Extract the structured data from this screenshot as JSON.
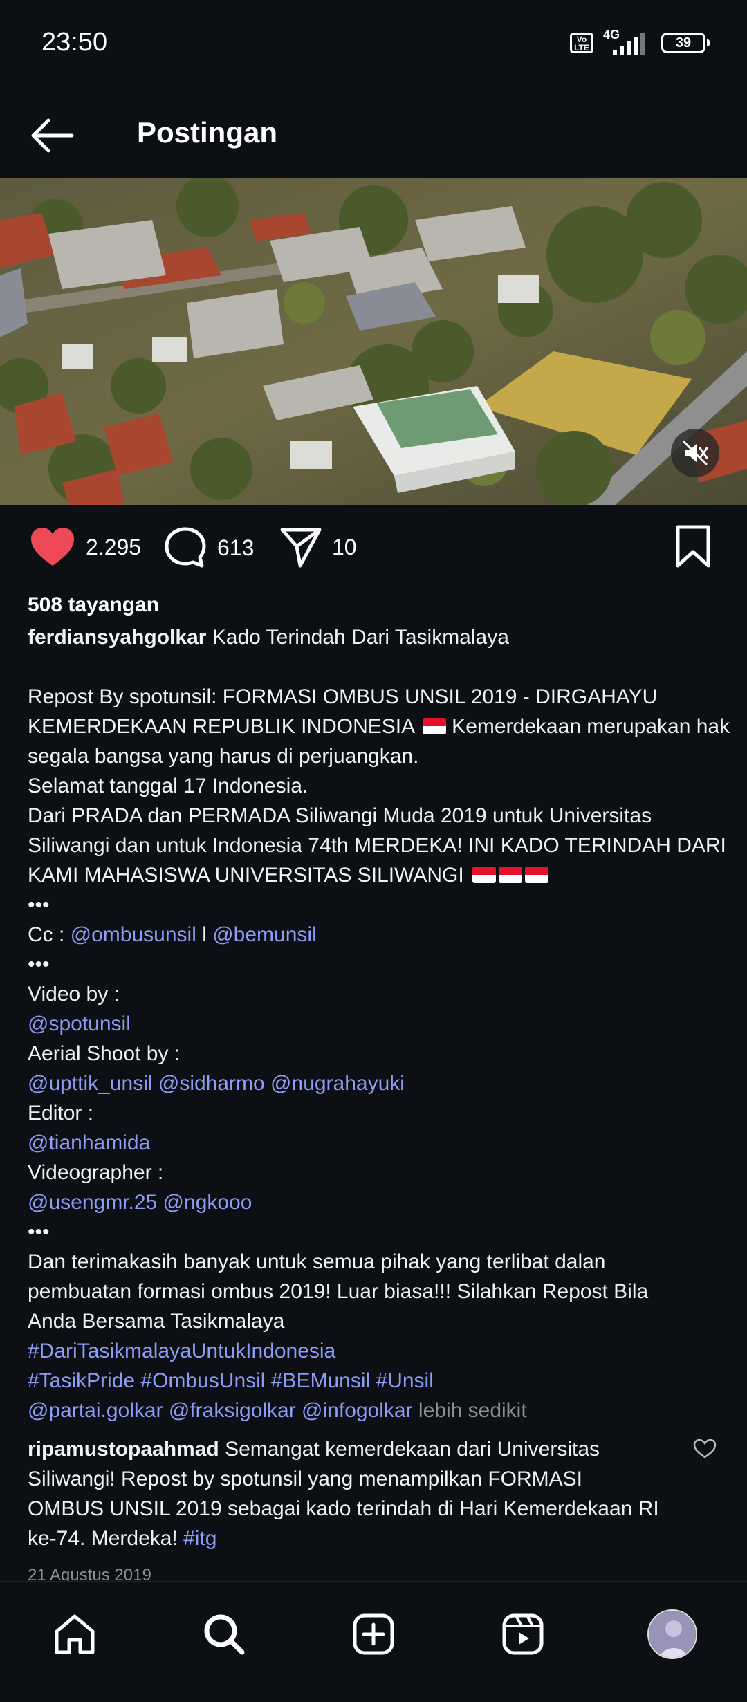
{
  "status": {
    "time": "23:50",
    "network": "4G",
    "volte_top": "Vo",
    "volte_bottom": "LTE",
    "battery": "39"
  },
  "header": {
    "title": "Postingan"
  },
  "post": {
    "likes": "2.295",
    "comments": "613",
    "shares": "10",
    "views": "508 tayangan",
    "author": "ferdiansyahgolkar",
    "title_text": " Kado Terindah Dari Tasikmalaya",
    "caption": {
      "l1": "Repost By spotunsil: FORMASI OMBUS UNSIL 2019 - DIRGAHAYU",
      "l2": "KEMERDEKAAN REPUBLIK INDONESIA",
      "l2b": " Kemerdekaan merupakan hak",
      "l3": "segala bangsa yang harus di perjuangkan.",
      "l4": "Selamat tanggal 17 Indonesia.",
      "l5": "Dari PRADA dan PERMADA Siliwangi Muda 2019 untuk Universitas",
      "l6": "Siliwangi dan untuk Indonesia 74th MERDEKA! INI KADO TERINDAH DARI",
      "l7": "KAMI MAHASISWA UNIVERSITAS SILIWANGI",
      "dots": "•••",
      "cc_label": "Cc : ",
      "cc_link1": "@ombusunsil",
      "cc_sep": " l ",
      "cc_link2": "@bemunsil",
      "video_by": "Video by :",
      "video_by_user": "@spotunsil",
      "aerial_by": "Aerial Shoot by :",
      "aerial_users": "@upttik_unsil @sidharmo @nugrahayuki",
      "editor": "Editor :",
      "editor_user": "@tianhamida",
      "videographer": "Videographer :",
      "videographer_users": "@usengmr.25 @ngkooo",
      "thanks1": "Dan terimakasih banyak untuk semua pihak yang terlibat dalan",
      "thanks2": "pembuatan formasi ombus 2019! Luar biasa!!! Silahkan Repost Bila",
      "thanks3": "Anda Bersama Tasikmalaya",
      "hashtag1": "#DariTasikmalayaUntukIndonesia",
      "hashtags2": "#TasikPride #OmbusUnsil #BEMunsil #Unsil",
      "mentions": "@partai.golkar @fraksigolkar @infogolkar",
      "less": " lebih sedikit"
    }
  },
  "comment": {
    "user": "ripamustopaahmad",
    "t1": " Semangat kemerdekaan dari Universitas",
    "t2": "Siliwangi! Repost by spotunsil yang menampilkan FORMASI",
    "t3": "OMBUS UNSIL 2019 sebagai kado terindah di Hari Kemerdekaan RI",
    "t4": "ke-74. Merdeka! ",
    "tag": "#itg"
  },
  "date": "21 Agustus 2019",
  "colors": {
    "background": "#0c0f14",
    "like": "#ed4956",
    "link": "#8c9df5",
    "muted": "#8e8e8e"
  },
  "nav": {
    "items": [
      "home-icon",
      "search-icon",
      "create-icon",
      "reels-icon",
      "profile-avatar"
    ]
  }
}
